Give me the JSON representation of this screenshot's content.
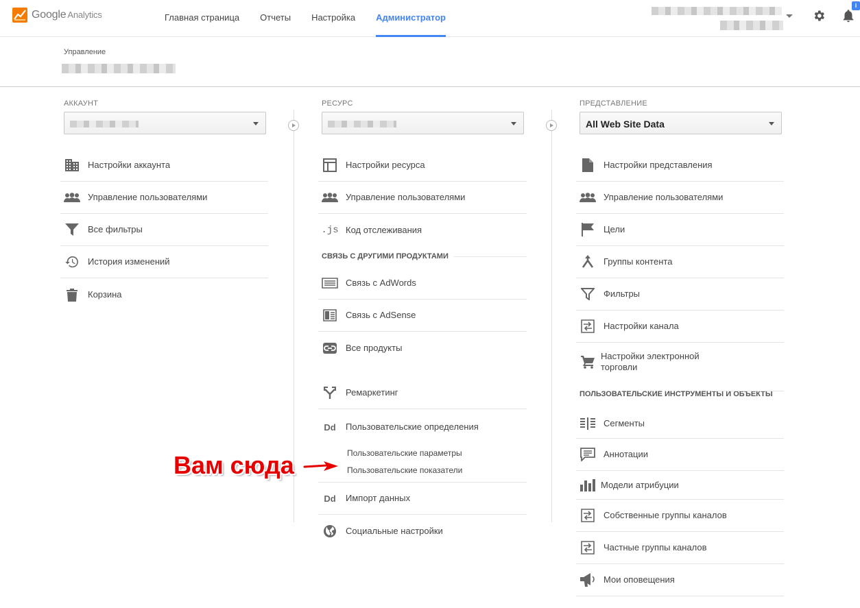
{
  "header": {
    "logo_text": "Google",
    "logo_sub": "Analytics",
    "nav": [
      "Главная страница",
      "Отчеты",
      "Настройка",
      "Администратор"
    ],
    "notification_badge": "i"
  },
  "management": {
    "label": "Управление"
  },
  "account": {
    "label": "Аккаунт",
    "items": [
      "Настройки аккаунта",
      "Управление пользователями",
      "Все фильтры",
      "История изменений",
      "Корзина"
    ]
  },
  "property": {
    "label": "Ресурс",
    "items_top": [
      "Настройки ресурса",
      "Управление пользователями",
      "Код отслеживания"
    ],
    "section_links": "Связь с другими продуктами",
    "items_links": [
      "Связь с AdWords",
      "Связь с AdSense",
      "Все продукты"
    ],
    "remarketing": "Ремаркетинг",
    "custom_definitions": "Пользовательские определения",
    "custom_dimensions": "Пользовательские параметры",
    "custom_metrics": "Пользовательские показатели",
    "data_import": "Импорт данных",
    "social": "Социальные настройки"
  },
  "view": {
    "label": "Представление",
    "selected": "All Web Site Data",
    "items_top": [
      "Настройки представления",
      "Управление пользователями",
      "Цели",
      "Группы контента",
      "Фильтры",
      "Настройки канала",
      "Настройки электронной торговли"
    ],
    "section_tools": "Пользовательские инструменты и объекты",
    "items_tools": [
      "Сегменты",
      "Аннотации",
      "Модели атрибуции",
      "Собственные группы каналов",
      "Частные группы каналов",
      "Мои оповещения"
    ]
  },
  "annotation": {
    "text": "Вам сюда"
  },
  "colors": {
    "accent": "#4285f4",
    "annotation": "#e60000",
    "logo_orange": "#f57c00"
  }
}
